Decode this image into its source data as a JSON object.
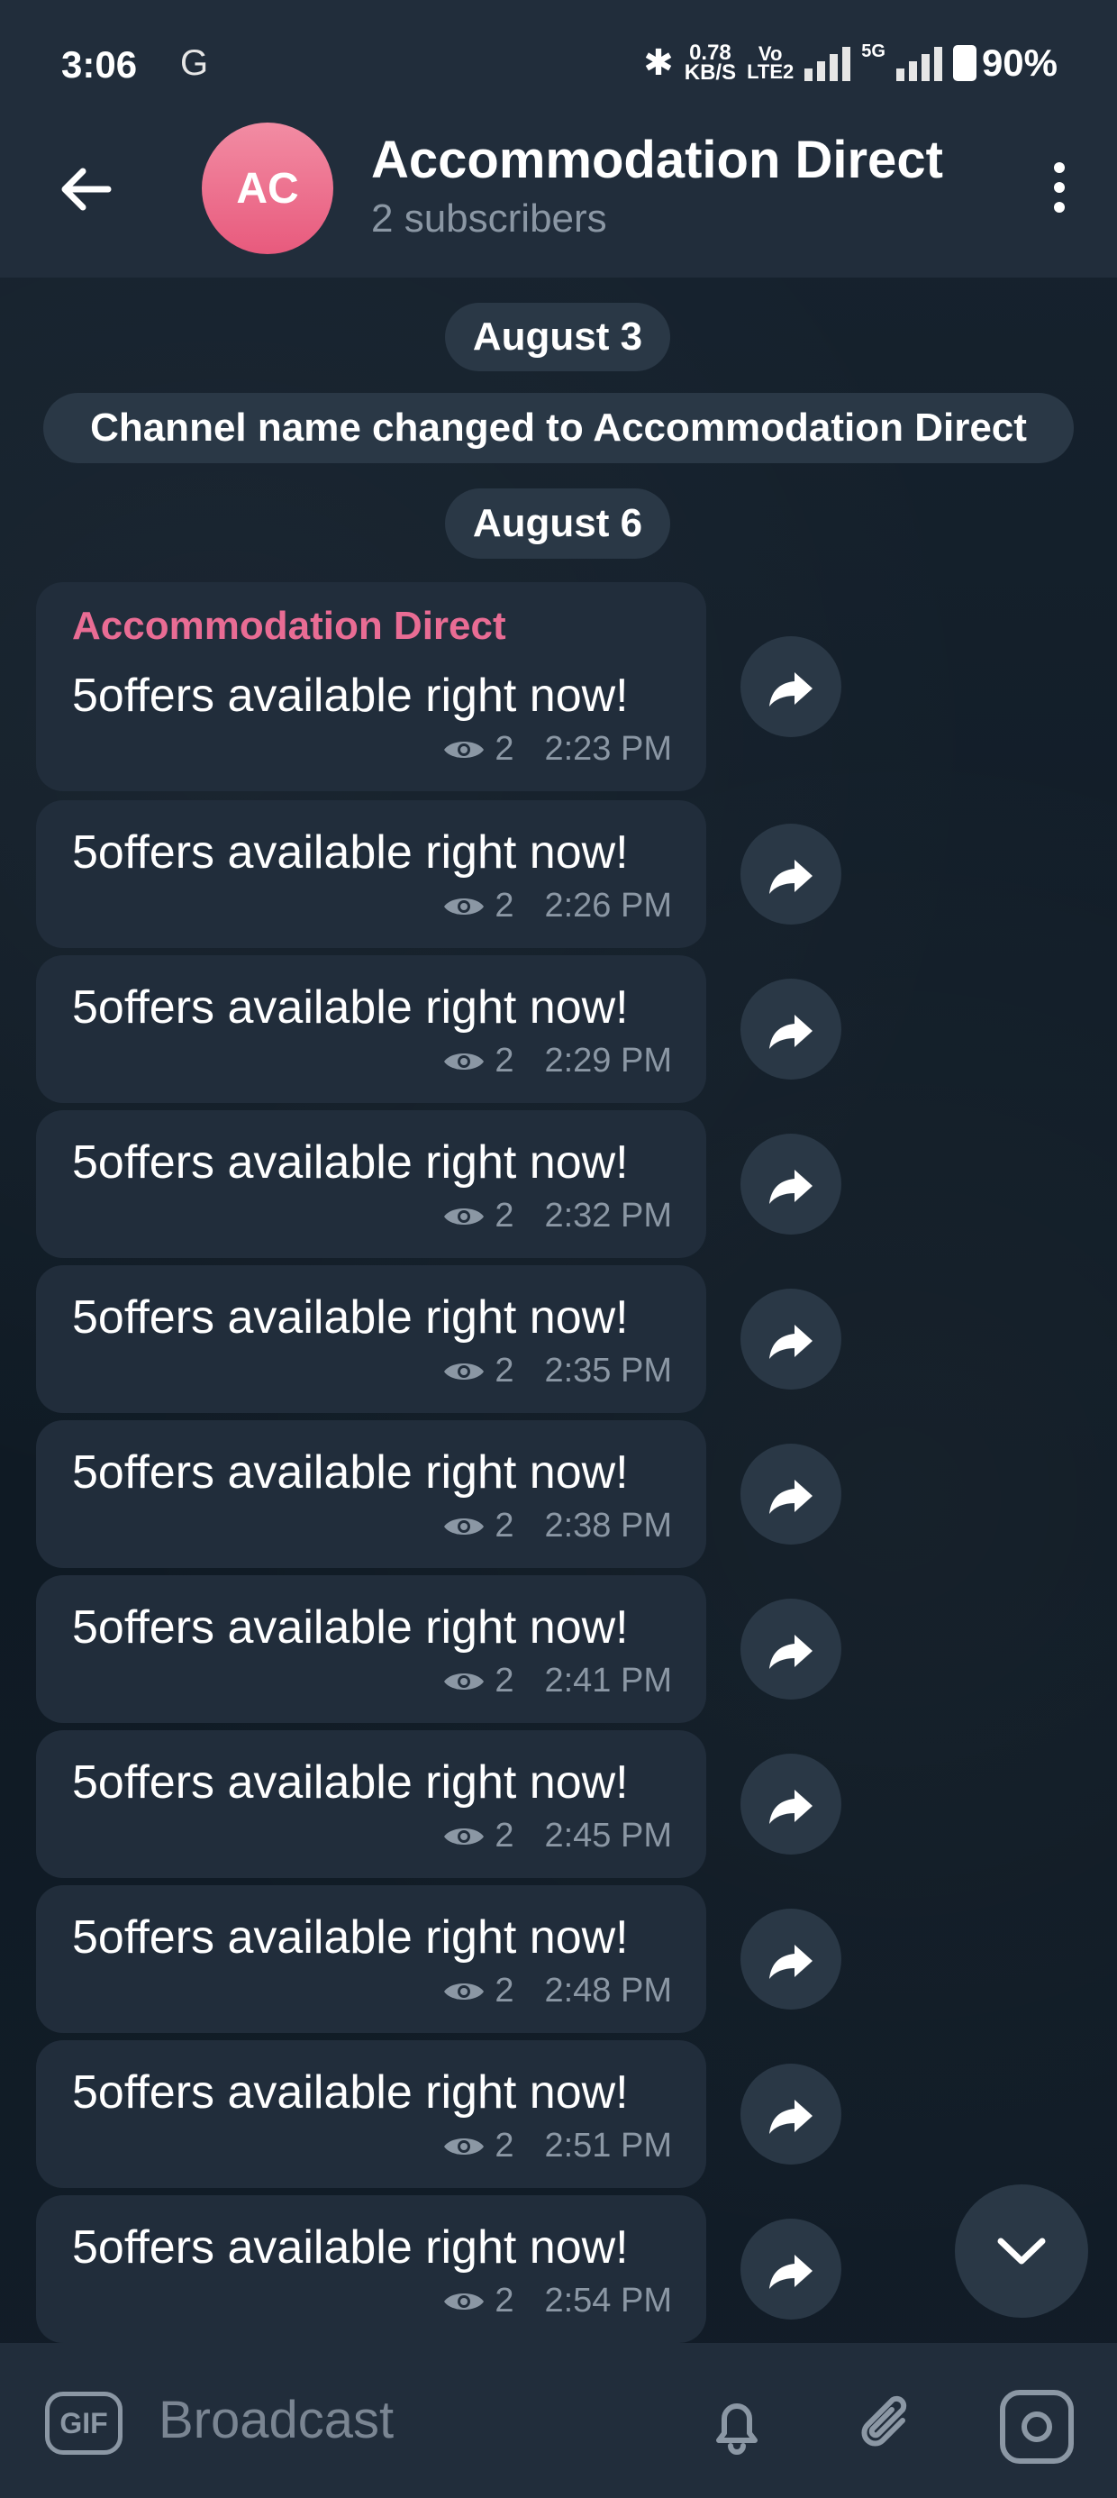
{
  "status_bar": {
    "time": "3:06",
    "carrier_icon": "G",
    "speed_value": "0.78",
    "speed_unit": "KB/S",
    "volte_top": "Vo",
    "volte_bottom": "LTE2",
    "network": "5G",
    "battery": "90%"
  },
  "header": {
    "avatar_initials": "AC",
    "title": "Accommodation Direct",
    "subtitle": "2 subscribers",
    "accent": "#e96c94"
  },
  "chips": {
    "date1": "August 3",
    "service": "Channel name changed to Accommodation Direct",
    "date2": "August 6"
  },
  "messages": [
    {
      "author": "Accommodation Direct",
      "text": "5offers available right now!",
      "views": "2",
      "time": "2:23 PM"
    },
    {
      "text": "5offers available right now!",
      "views": "2",
      "time": "2:26 PM"
    },
    {
      "text": "5offers available right now!",
      "views": "2",
      "time": "2:29 PM"
    },
    {
      "text": "5offers available right now!",
      "views": "2",
      "time": "2:32 PM"
    },
    {
      "text": "5offers available right now!",
      "views": "2",
      "time": "2:35 PM"
    },
    {
      "text": "5offers available right now!",
      "views": "2",
      "time": "2:38 PM"
    },
    {
      "text": "5offers available right now!",
      "views": "2",
      "time": "2:41 PM"
    },
    {
      "text": "5offers available right now!",
      "views": "2",
      "time": "2:45 PM"
    },
    {
      "text": "5offers available right now!",
      "views": "2",
      "time": "2:48 PM"
    },
    {
      "text": "5offers available right now!",
      "views": "2",
      "time": "2:51 PM"
    },
    {
      "text": "5offers available right now!",
      "views": "2",
      "time": "2:54 PM"
    }
  ],
  "bottom_bar": {
    "gif_label": "GIF",
    "placeholder": "Broadcast"
  }
}
